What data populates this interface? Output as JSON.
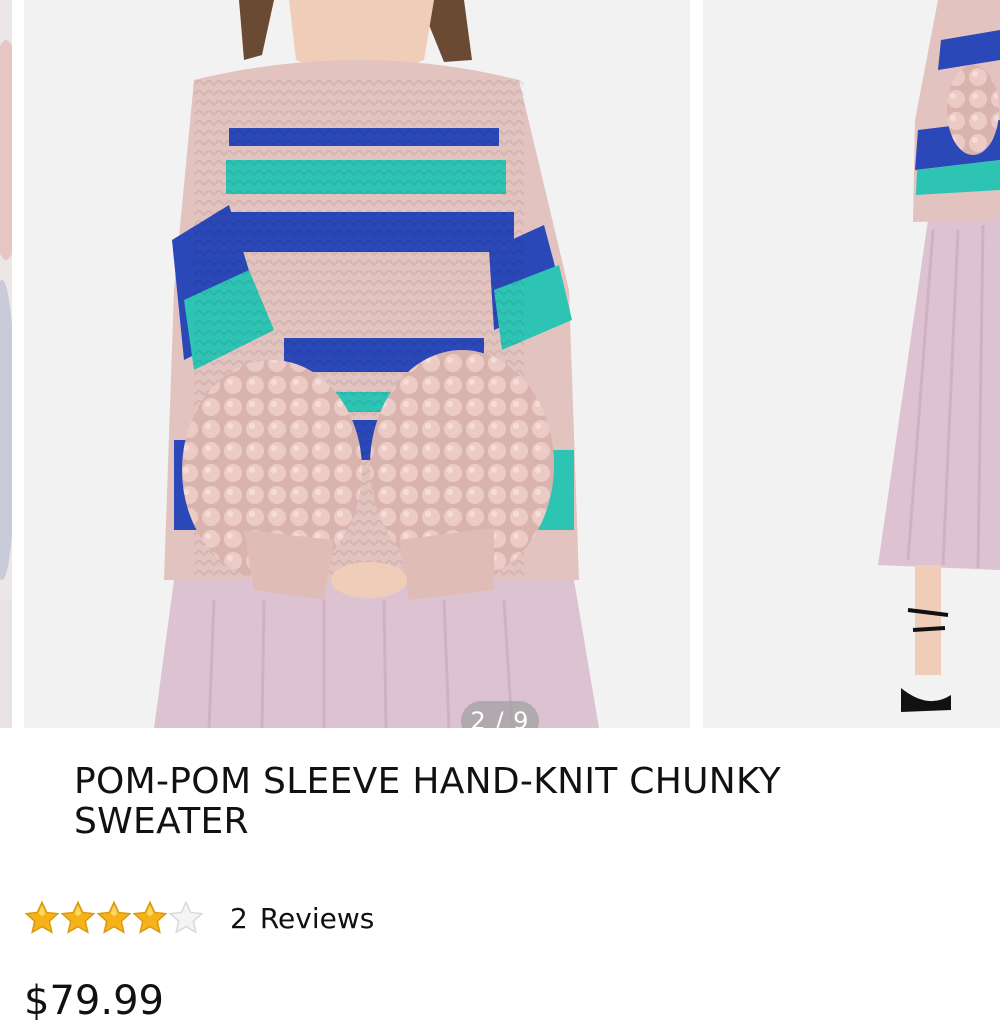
{
  "gallery": {
    "counter_text": "2 / 9",
    "current_index": 2,
    "total_images": 9
  },
  "product": {
    "title": "POM-POM SLEEVE HAND-KNIT CHUNKY SWEATER",
    "rating": 4,
    "rating_max": 5,
    "reviews_count": "2",
    "reviews_label": "Reviews",
    "price": "$79.99"
  },
  "icons": {
    "star_filled": "star-filled-icon",
    "star_empty": "star-empty-icon"
  },
  "colors": {
    "star_gold": "#f6b319",
    "star_empty": "#d9d9d9",
    "text": "#111111",
    "sweater_pink": "#e3c3bf",
    "stripe_blue": "#2a48b8",
    "stripe_teal": "#2ec4b4",
    "skirt_lilac": "#ddc3d1"
  }
}
